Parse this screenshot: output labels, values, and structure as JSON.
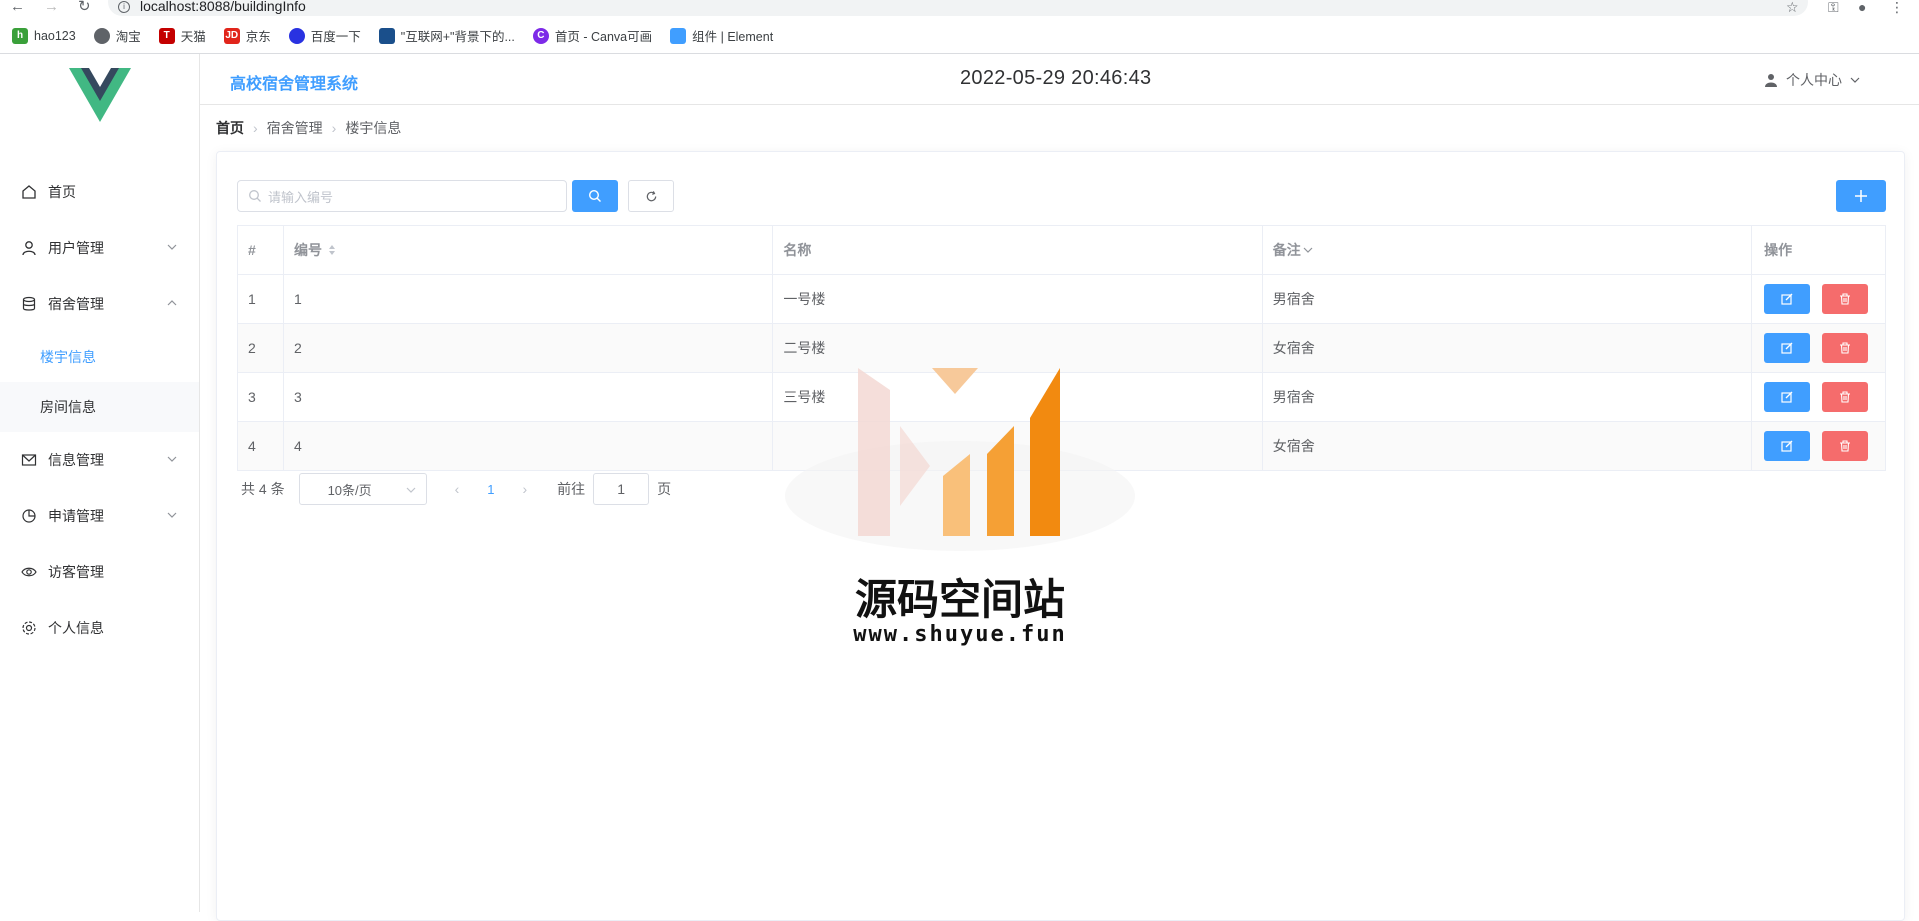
{
  "browser": {
    "url": "localhost:8088/buildingInfo",
    "bookmarks": [
      {
        "label": "hao123",
        "icon": "hao123-icon",
        "color": "#3aa03a"
      },
      {
        "label": "淘宝",
        "icon": "globe-icon",
        "color": "#5f6368"
      },
      {
        "label": "天猫",
        "icon": "tmall-icon",
        "color": "#c40000"
      },
      {
        "label": "京东",
        "icon": "jd-icon",
        "color": "#e1251b"
      },
      {
        "label": "百度一下",
        "icon": "baidu-icon",
        "color": "#2932e1"
      },
      {
        "label": "\"互联网+\"背景下的...",
        "icon": "doc-icon",
        "color": "#1a4f8b"
      },
      {
        "label": "首页 - Canva可画",
        "icon": "canva-icon",
        "color": "#7d2ae8"
      },
      {
        "label": "组件 | Element",
        "icon": "element-icon",
        "color": "#409eff"
      }
    ]
  },
  "header": {
    "title": "高校宿舍管理系统",
    "datetime": "2022-05-29 20:46:43",
    "user_menu": "个人中心"
  },
  "sidebar": {
    "items": [
      {
        "label": "首页",
        "icon": "home-icon"
      },
      {
        "label": "用户管理",
        "icon": "user-icon"
      },
      {
        "label": "宿舍管理",
        "icon": "database-icon"
      },
      {
        "label": "信息管理",
        "icon": "mail-icon"
      },
      {
        "label": "申请管理",
        "icon": "pie-chart-icon"
      },
      {
        "label": "访客管理",
        "icon": "eye-icon"
      },
      {
        "label": "个人信息",
        "icon": "gear-icon"
      }
    ],
    "sub_items": [
      "楼宇信息",
      "房间信息"
    ]
  },
  "breadcrumb": [
    "首页",
    "宿舍管理",
    "楼宇信息"
  ],
  "search": {
    "placeholder": "请输入编号"
  },
  "table": {
    "headers": [
      "#",
      "编号",
      "名称",
      "备注",
      "操作"
    ],
    "rows": [
      {
        "idx": "1",
        "code": "1",
        "name": "一号楼",
        "remark": "男宿舍"
      },
      {
        "idx": "2",
        "code": "2",
        "name": "二号楼",
        "remark": "女宿舍"
      },
      {
        "idx": "3",
        "code": "3",
        "name": "三号楼",
        "remark": "男宿舍"
      },
      {
        "idx": "4",
        "code": "4",
        "name": "",
        "remark": "女宿舍"
      }
    ]
  },
  "pagination": {
    "total": "共 4 条",
    "page_size": "10条/页",
    "current": "1",
    "goto_prefix": "前往",
    "goto_value": "1",
    "goto_suffix": "页"
  },
  "watermark": {
    "title": "源码空间站",
    "url": "www.shuyue.fun"
  },
  "colors": {
    "primary": "#409eff",
    "danger": "#f56c6c",
    "vue_green": "#41b883",
    "vue_dark": "#35495e"
  }
}
